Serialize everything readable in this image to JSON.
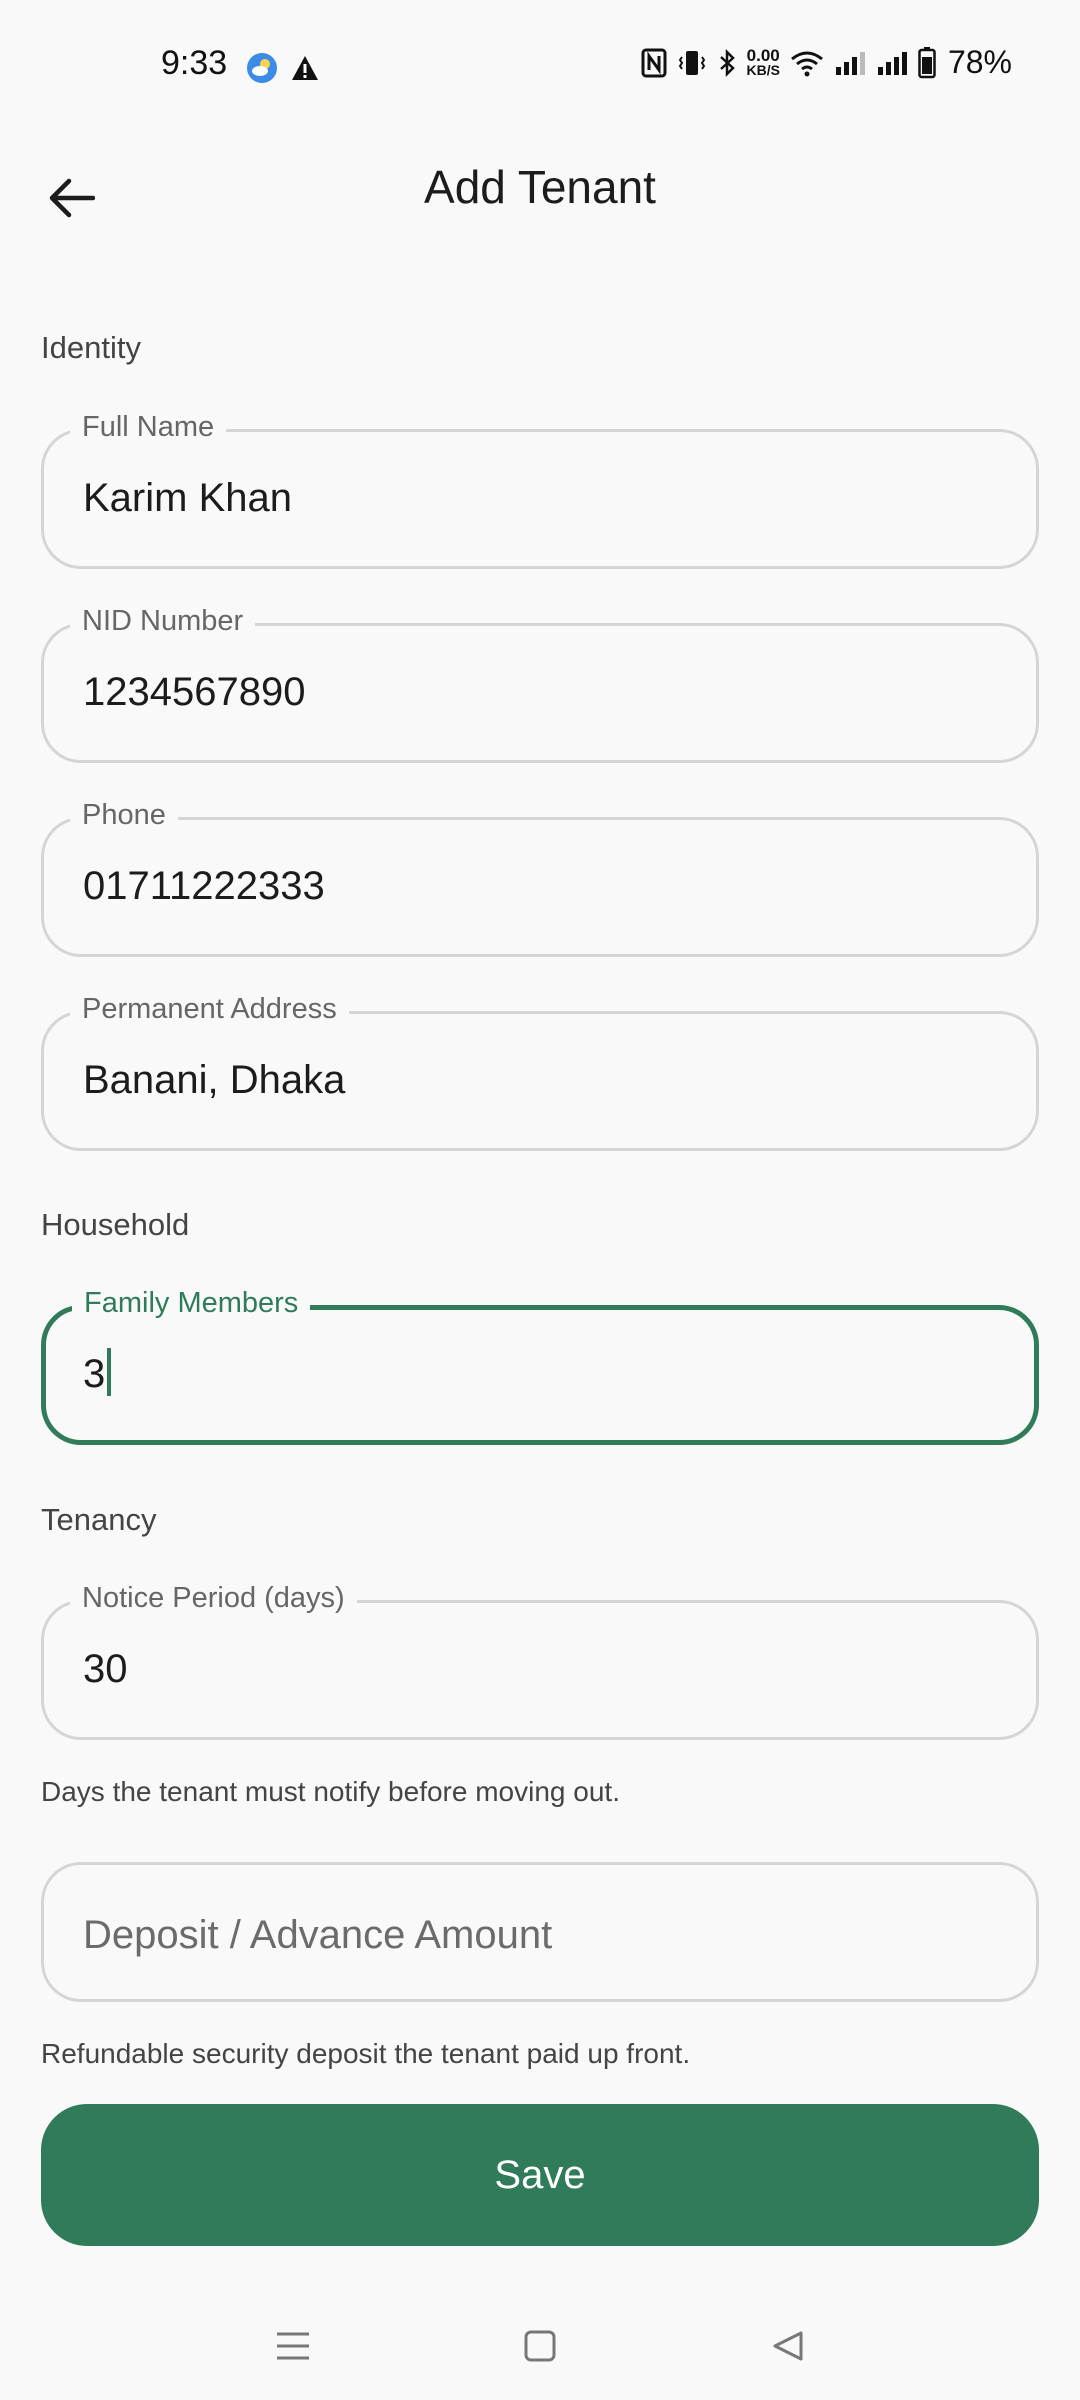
{
  "status_bar": {
    "time": "9:33",
    "net_speed_value": "0.00",
    "net_speed_unit": "KB/S",
    "battery_percent": "78%"
  },
  "app_bar": {
    "title": "Add Tenant",
    "back_icon": "arrow-left-icon"
  },
  "sections": {
    "identity": "Identity",
    "household": "Household",
    "tenancy": "Tenancy"
  },
  "fields": {
    "full_name": {
      "label": "Full Name",
      "value": "Karim Khan"
    },
    "nid_number": {
      "label": "NID Number",
      "value": "1234567890"
    },
    "phone": {
      "label": "Phone",
      "value": "01711222333"
    },
    "permanent_address": {
      "label": "Permanent Address",
      "value": "Banani, Dhaka"
    },
    "family_members": {
      "label": "Family Members",
      "value": "3"
    },
    "notice_period": {
      "label": "Notice Period (days)",
      "value": "30",
      "helper": "Days the tenant must notify before moving out."
    },
    "deposit": {
      "placeholder": "Deposit / Advance Amount",
      "helper": "Refundable security deposit the tenant paid up front."
    }
  },
  "actions": {
    "save_label": "Save"
  },
  "colors": {
    "accent": "#2f7b5a",
    "border": "#d4d6d4",
    "background": "#f9f9f9"
  }
}
